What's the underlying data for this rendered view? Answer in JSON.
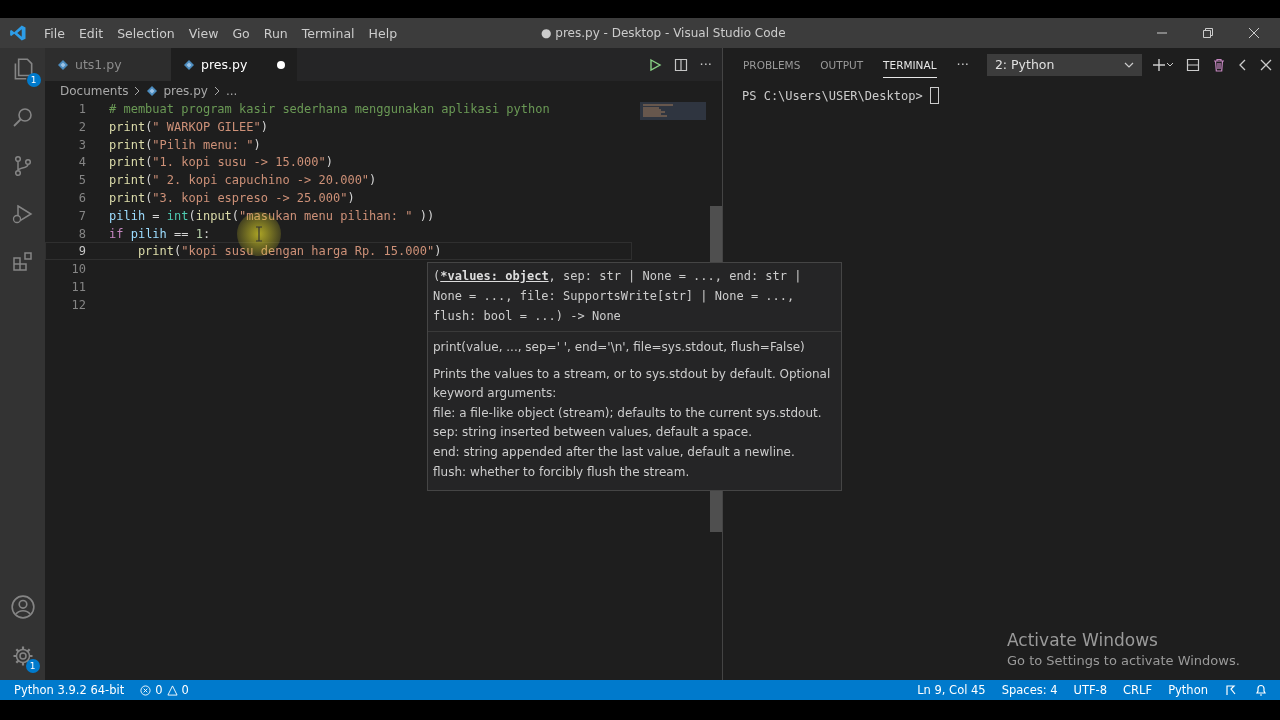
{
  "window": {
    "title": "● pres.py - Desktop - Visual Studio Code"
  },
  "menu": [
    "File",
    "Edit",
    "Selection",
    "View",
    "Go",
    "Run",
    "Terminal",
    "Help"
  ],
  "activity_bar": {
    "explorer_badge": "1",
    "settings_badge": "1"
  },
  "editor_tabs": [
    {
      "label": "uts1.py",
      "selected": false,
      "modified": false
    },
    {
      "label": "pres.py",
      "selected": true,
      "modified": true
    }
  ],
  "editor_actions": {
    "more": "···"
  },
  "breadcrumb": {
    "folder": "Documents",
    "file": "pres.py",
    "rest": "..."
  },
  "code": [
    {
      "number": "1",
      "tokens": [
        {
          "kind": "comment",
          "text": "# membuat program kasir sederhana menggunakan aplikasi python"
        }
      ]
    },
    {
      "number": "2",
      "tokens": [
        {
          "kind": "function",
          "text": "print"
        },
        {
          "kind": "plain",
          "text": "("
        },
        {
          "kind": "string",
          "text": "\" WARKOP GILEE\""
        },
        {
          "kind": "plain",
          "text": ")"
        }
      ]
    },
    {
      "number": "3",
      "tokens": [
        {
          "kind": "function",
          "text": "print"
        },
        {
          "kind": "plain",
          "text": "("
        },
        {
          "kind": "string",
          "text": "\"Pilih menu: \""
        },
        {
          "kind": "plain",
          "text": ")"
        }
      ]
    },
    {
      "number": "4",
      "tokens": [
        {
          "kind": "function",
          "text": "print"
        },
        {
          "kind": "plain",
          "text": "("
        },
        {
          "kind": "string",
          "text": "\"1. kopi susu -> 15.000\""
        },
        {
          "kind": "plain",
          "text": ")"
        }
      ]
    },
    {
      "number": "5",
      "tokens": [
        {
          "kind": "function",
          "text": "print"
        },
        {
          "kind": "plain",
          "text": "("
        },
        {
          "kind": "string",
          "text": "\" 2. kopi capuchino -> 20.000\""
        },
        {
          "kind": "plain",
          "text": ")"
        }
      ]
    },
    {
      "number": "6",
      "tokens": [
        {
          "kind": "function",
          "text": "print"
        },
        {
          "kind": "plain",
          "text": "("
        },
        {
          "kind": "string",
          "text": "\"3. kopi espreso -> 25.000\""
        },
        {
          "kind": "plain",
          "text": ")"
        }
      ]
    },
    {
      "number": "7",
      "tokens": [
        {
          "kind": "variable",
          "text": "pilih"
        },
        {
          "kind": "plain",
          "text": " ="
        },
        {
          "kind": "type",
          "text": " int"
        },
        {
          "kind": "plain",
          "text": "("
        },
        {
          "kind": "function",
          "text": "input"
        },
        {
          "kind": "plain",
          "text": "("
        },
        {
          "kind": "string",
          "text": "\"masukan menu pilihan: \""
        },
        {
          "kind": "plain",
          "text": " ))"
        }
      ]
    },
    {
      "number": "8",
      "tokens": [
        {
          "kind": "keyword",
          "text": "if"
        },
        {
          "kind": "variable",
          "text": " pilih"
        },
        {
          "kind": "plain",
          "text": " == "
        },
        {
          "kind": "number",
          "text": "1"
        },
        {
          "kind": "plain",
          "text": ":"
        }
      ]
    },
    {
      "number": "9",
      "current": true,
      "tokens": [
        {
          "kind": "function",
          "text": "    print"
        },
        {
          "kind": "plain",
          "text": "("
        },
        {
          "kind": "string",
          "text": "\"kopi susu dengan harga Rp. 15.000\""
        },
        {
          "kind": "plain",
          "text": ")"
        }
      ]
    },
    {
      "number": "10"
    },
    {
      "number": "11"
    },
    {
      "number": "12"
    }
  ],
  "hover": {
    "signature": {
      "open": "(",
      "param": "*values: object",
      "rest": ", sep: str | None = ..., end: str | None = ..., file: SupportsWrite[str] | None = ..., flush: bool = ...) -> None"
    },
    "usage": "print(value, ..., sep=' ', end='\\n', file=sys.stdout, flush=False)",
    "doc": [
      "Prints the values to a stream, or to sys.stdout by default. Optional keyword arguments:",
      "file: a file-like object (stream); defaults to the current sys.stdout.",
      "sep: string inserted between values, default a space.",
      "end: string appended after the last value, default a newline.",
      "flush: whether to forcibly flush the stream."
    ]
  },
  "panel": {
    "tabs": [
      {
        "label": "PROBLEMS",
        "selected": false
      },
      {
        "label": "OUTPUT",
        "selected": false
      },
      {
        "label": "TERMINAL",
        "selected": true
      }
    ],
    "more": "···",
    "terminal_select": "2: Python",
    "prompt": "PS C:\\Users\\USER\\Desktop> "
  },
  "activation": {
    "title": "Activate Windows",
    "subtitle": "Go to Settings to activate Windows."
  },
  "status_bar": {
    "interpreter": "Python 3.9.2 64-bit",
    "errors": "0",
    "warnings": "0",
    "right": [
      "Ln 9, Col 45",
      "Spaces: 4",
      "UTF-8",
      "CRLF",
      "Python"
    ]
  }
}
